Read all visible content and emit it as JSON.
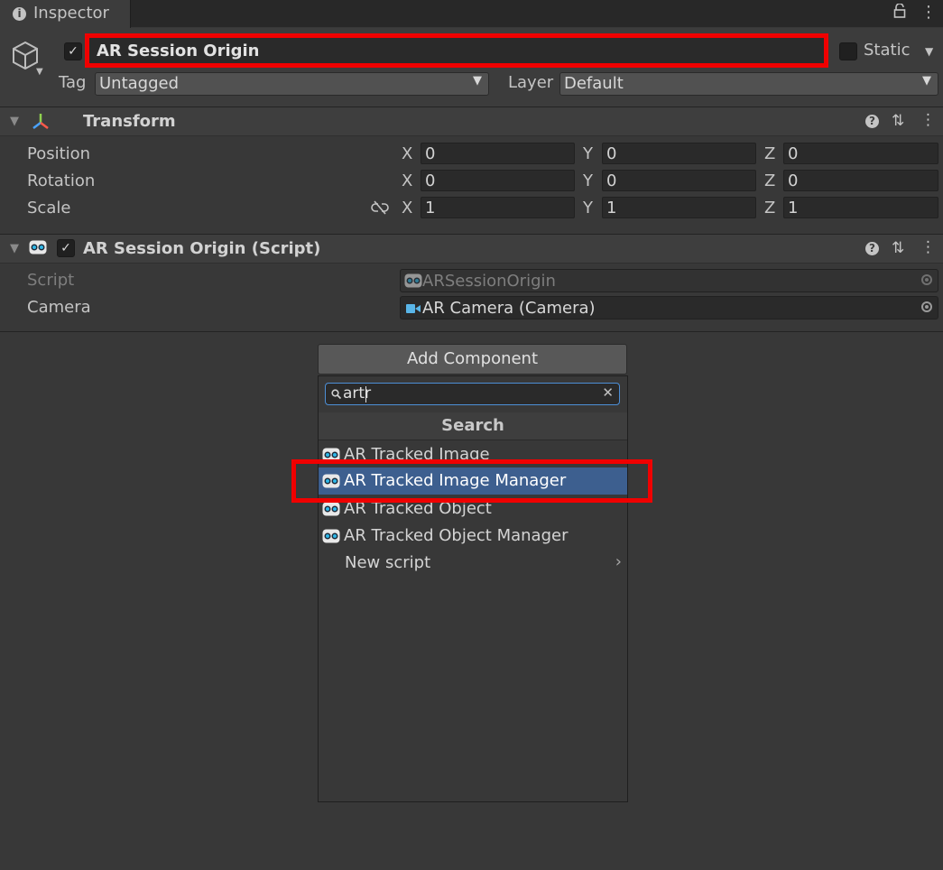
{
  "window": {
    "tab_label": "Inspector"
  },
  "header": {
    "active": true,
    "object_name": "AR Session Origin",
    "static_label": "Static",
    "tag_label": "Tag",
    "tag_value": "Untagged",
    "layer_label": "Layer",
    "layer_value": "Default"
  },
  "transform": {
    "title": "Transform",
    "rows": [
      {
        "label": "Position",
        "x": "0",
        "y": "0",
        "z": "0"
      },
      {
        "label": "Rotation",
        "x": "0",
        "y": "0",
        "z": "0"
      },
      {
        "label": "Scale",
        "x": "1",
        "y": "1",
        "z": "1"
      }
    ],
    "axes": {
      "x": "X",
      "y": "Y",
      "z": "Z"
    }
  },
  "script_component": {
    "title": "AR Session Origin (Script)",
    "enabled": true,
    "script_label": "Script",
    "script_value": "ARSessionOrigin",
    "camera_label": "Camera",
    "camera_value": "AR Camera (Camera)"
  },
  "add_component": {
    "button_label": "Add Component",
    "search_value": "artr",
    "search_header": "Search",
    "results": [
      {
        "label": "AR Tracked Image",
        "selected": false
      },
      {
        "label": "AR Tracked Image Manager",
        "selected": true
      },
      {
        "label": "AR Tracked Object",
        "selected": false
      },
      {
        "label": "AR Tracked Object Manager",
        "selected": false
      }
    ],
    "new_script_label": "New script"
  },
  "colors": {
    "background": "#383838",
    "selection": "#3d5f8f",
    "highlight_box": "#f00000",
    "search_focus": "#4d8fd6"
  }
}
